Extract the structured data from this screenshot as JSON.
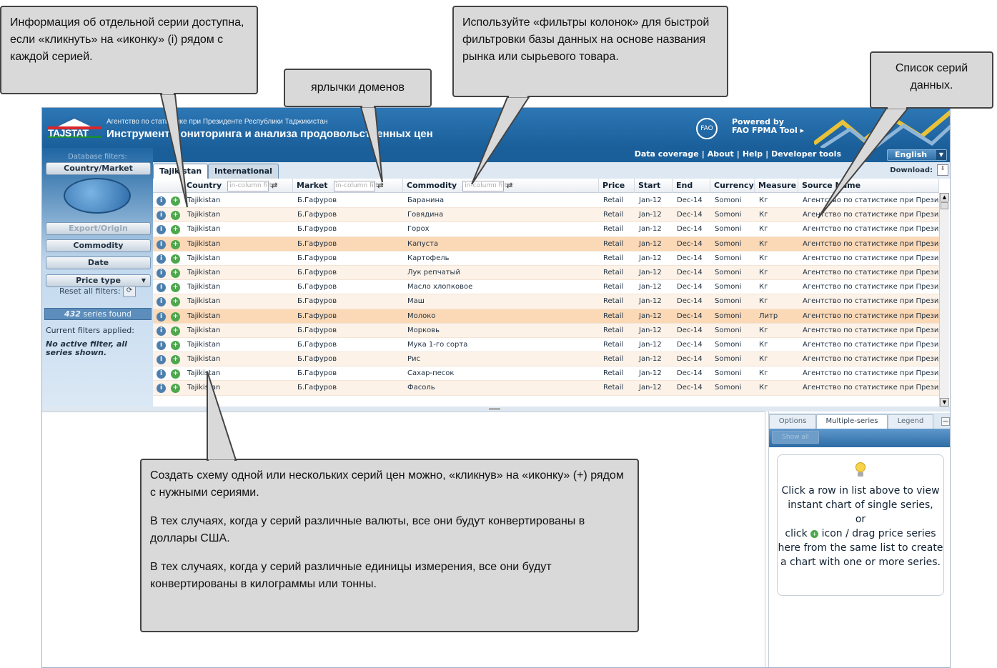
{
  "header": {
    "logo_text": "TAJSTAT",
    "agency": "Агентство по статистике при Президенте Республики Таджикистан",
    "title": "Инструмент мониторинга и анализа продовольственных цен",
    "powered_line1": "Powered by",
    "powered_line2": "FAO FPMA Tool ▸",
    "fao_icon": "FAO"
  },
  "nav": {
    "links": [
      "Data coverage",
      "About",
      "Help",
      "Developer tools"
    ],
    "language": "English",
    "download_label": "Download:"
  },
  "sidebar": {
    "db_filters": "Database filters:",
    "country_market": "Country/Market",
    "export_origin": "Export/Origin",
    "commodity": "Commodity",
    "date": "Date",
    "price_type": "Price type",
    "reset": "Reset all filters:",
    "found_count": "432",
    "found_text": " series found",
    "current_filters": "Current filters applied:",
    "no_filter": "No active filter, all series shown."
  },
  "tabs": [
    "Tajikistan",
    "International"
  ],
  "grid": {
    "columns": [
      "Country",
      "Market",
      "Commodity",
      "Price",
      "Start",
      "End",
      "Currency",
      "Measure",
      "Source Name"
    ],
    "filter_placeholder": "in-column filter",
    "rows": [
      [
        "Tajikistan",
        "Б.Гафуров",
        "Баранина",
        "Retail",
        "Jan-12",
        "Dec-14",
        "Somoni",
        "Кг",
        "Агентство по статистике при Президенте"
      ],
      [
        "Tajikistan",
        "Б.Гафуров",
        "Говядина",
        "Retail",
        "Jan-12",
        "Dec-14",
        "Somoni",
        "Кг",
        "Агентство по статистике при Президенте"
      ],
      [
        "Tajikistan",
        "Б.Гафуров",
        "Горох",
        "Retail",
        "Jan-12",
        "Dec-14",
        "Somoni",
        "Кг",
        "Агентство по статистике при Президенте"
      ],
      [
        "Tajikistan",
        "Б.Гафуров",
        "Капуста",
        "Retail",
        "Jan-12",
        "Dec-14",
        "Somoni",
        "Кг",
        "Агентство по статистике при Президенте"
      ],
      [
        "Tajikistan",
        "Б.Гафуров",
        "Картофель",
        "Retail",
        "Jan-12",
        "Dec-14",
        "Somoni",
        "Кг",
        "Агентство по статистике при Президенте"
      ],
      [
        "Tajikistan",
        "Б.Гафуров",
        "Лук репчатый",
        "Retail",
        "Jan-12",
        "Dec-14",
        "Somoni",
        "Кг",
        "Агентство по статистике при Президенте"
      ],
      [
        "Tajikistan",
        "Б.Гафуров",
        "Масло хлопковое",
        "Retail",
        "Jan-12",
        "Dec-14",
        "Somoni",
        "Кг",
        "Агентство по статистике при Президенте"
      ],
      [
        "Tajikistan",
        "Б.Гафуров",
        "Маш",
        "Retail",
        "Jan-12",
        "Dec-14",
        "Somoni",
        "Кг",
        "Агентство по статистике при Президенте"
      ],
      [
        "Tajikistan",
        "Б.Гафуров",
        "Молоко",
        "Retail",
        "Jan-12",
        "Dec-14",
        "Somoni",
        "Литр",
        "Агентство по статистике при Президенте"
      ],
      [
        "Tajikistan",
        "Б.Гафуров",
        "Морковь",
        "Retail",
        "Jan-12",
        "Dec-14",
        "Somoni",
        "Кг",
        "Агентство по статистике при Президенте"
      ],
      [
        "Tajikistan",
        "Б.Гафуров",
        "Мука 1-го сорта",
        "Retail",
        "Jan-12",
        "Dec-14",
        "Somoni",
        "Кг",
        "Агентство по статистике при Президенте"
      ],
      [
        "Tajikistan",
        "Б.Гафуров",
        "Рис",
        "Retail",
        "Jan-12",
        "Dec-14",
        "Somoni",
        "Кг",
        "Агентство по статистике при Президенте"
      ],
      [
        "Tajikistan",
        "Б.Гафуров",
        "Сахар-песок",
        "Retail",
        "Jan-12",
        "Dec-14",
        "Somoni",
        "Кг",
        "Агентство по статистике при Президенте"
      ],
      [
        "Tajikistan",
        "Б.Гафуров",
        "Фасоль",
        "Retail",
        "Jan-12",
        "Dec-14",
        "Somoni",
        "Кг",
        "Агентство по статистике при Президенте"
      ]
    ]
  },
  "right_panel": {
    "tabs": [
      "Options",
      "Multiple-series",
      "Legend"
    ],
    "show_all": "Show all",
    "hint_1": "Click a row in list above to view instant chart of single series,",
    "hint_or": "or",
    "hint_2a": "click",
    "hint_2b": "icon / drag price series here from the same list to create a chart with one or more series."
  },
  "callouts": {
    "info": "Информация об отдельной серии доступна, если «кликнуть» на «иконку» (i) рядом с каждой серией.",
    "domains": "ярлычки доменов",
    "filters": "Используйте «фильтры колонок» для быстрой фильтровки базы данных на основе названия рынка или сырьевого товара.",
    "list": "Список серий данных.",
    "create_1": "Создать схему одной или нескольких серий цен можно, «кликнув» на «иконку» (+) рядом с нужными сериями.",
    "create_2": "В тех случаях, когда у серий различные валюты, все они будут конвертированы в доллары США.",
    "create_3": "В тех случаях, когда у серий различные единицы измерения, все они будут конвертированы в килограммы или тонны."
  },
  "icons": {
    "info": "info-icon",
    "add": "add-series-icon",
    "refresh": "refresh-icon",
    "bulb": "lightbulb-icon"
  }
}
